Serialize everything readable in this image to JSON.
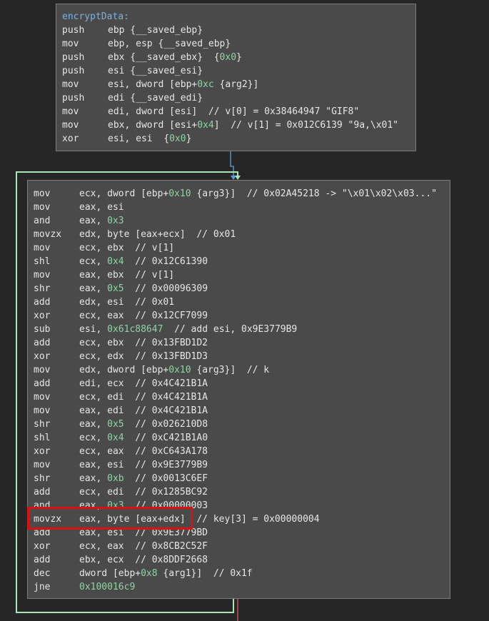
{
  "function_name": "encryptData:",
  "blocks": [
    {
      "lines": [
        {
          "m": "push",
          "o": [
            [
              "t",
              "ebp {__saved_ebp}"
            ]
          ]
        },
        {
          "m": "mov",
          "o": [
            [
              "t",
              "ebp, esp {__saved_ebp}"
            ]
          ]
        },
        {
          "m": "push",
          "o": [
            [
              "t",
              "ebx {__saved_ebx}  {"
            ],
            [
              "n",
              "0x0"
            ],
            [
              "t",
              "}"
            ]
          ]
        },
        {
          "m": "push",
          "o": [
            [
              "t",
              "esi {__saved_esi}"
            ]
          ]
        },
        {
          "m": "mov",
          "o": [
            [
              "t",
              "esi, dword [ebp+"
            ],
            [
              "n",
              "0xc"
            ],
            [
              "t",
              " {arg2}]"
            ]
          ]
        },
        {
          "m": "push",
          "o": [
            [
              "t",
              "edi {__saved_edi}"
            ]
          ]
        },
        {
          "m": "mov",
          "o": [
            [
              "t",
              "edi, dword [esi]  // v[0] = 0x38464947 \"GIF8\""
            ]
          ]
        },
        {
          "m": "mov",
          "o": [
            [
              "t",
              "ebx, dword [esi+"
            ],
            [
              "n",
              "0x4"
            ],
            [
              "t",
              "]  // v[1] = 0x012C6139 \"9a,\\x01\""
            ]
          ]
        },
        {
          "m": "xor",
          "o": [
            [
              "t",
              "esi, esi  {"
            ],
            [
              "n",
              "0x0"
            ],
            [
              "t",
              "}"
            ]
          ]
        }
      ]
    },
    {
      "lines": [
        {
          "m": "mov",
          "o": [
            [
              "t",
              "ecx, dword [ebp+"
            ],
            [
              "n",
              "0x10"
            ],
            [
              "t",
              " {arg3}]  // 0x02A45218 -> \"\\x01\\x02\\x03...\""
            ]
          ]
        },
        {
          "m": "mov",
          "o": [
            [
              "t",
              "eax, esi"
            ]
          ]
        },
        {
          "m": "and",
          "o": [
            [
              "t",
              "eax, "
            ],
            [
              "n",
              "0x3"
            ]
          ]
        },
        {
          "m": "movzx",
          "o": [
            [
              "t",
              "edx, byte [eax+ecx]  // 0x01"
            ]
          ]
        },
        {
          "m": "mov",
          "o": [
            [
              "t",
              "ecx, ebx  // v[1]"
            ]
          ]
        },
        {
          "m": "shl",
          "o": [
            [
              "t",
              "ecx, "
            ],
            [
              "n",
              "0x4"
            ],
            [
              "t",
              "  // 0x12C61390"
            ]
          ]
        },
        {
          "m": "mov",
          "o": [
            [
              "t",
              "eax, ebx  // v[1]"
            ]
          ]
        },
        {
          "m": "shr",
          "o": [
            [
              "t",
              "eax, "
            ],
            [
              "n",
              "0x5"
            ],
            [
              "t",
              "  // 0x00096309"
            ]
          ]
        },
        {
          "m": "add",
          "o": [
            [
              "t",
              "edx, esi  // 0x01"
            ]
          ]
        },
        {
          "m": "xor",
          "o": [
            [
              "t",
              "ecx, eax  // 0x12CF7099"
            ]
          ]
        },
        {
          "m": "sub",
          "o": [
            [
              "t",
              "esi, "
            ],
            [
              "n",
              "0x61c88647"
            ],
            [
              "t",
              "  // add esi, 0x9E3779B9"
            ]
          ]
        },
        {
          "m": "add",
          "o": [
            [
              "t",
              "ecx, ebx  // 0x13FBD1D2"
            ]
          ]
        },
        {
          "m": "xor",
          "o": [
            [
              "t",
              "ecx, edx  // 0x13FBD1D3"
            ]
          ]
        },
        {
          "m": "mov",
          "o": [
            [
              "t",
              "edx, dword [ebp+"
            ],
            [
              "n",
              "0x10"
            ],
            [
              "t",
              " {arg3}]  // k"
            ]
          ]
        },
        {
          "m": "add",
          "o": [
            [
              "t",
              "edi, ecx  // 0x4C421B1A"
            ]
          ]
        },
        {
          "m": "mov",
          "o": [
            [
              "t",
              "ecx, edi  // 0x4C421B1A"
            ]
          ]
        },
        {
          "m": "mov",
          "o": [
            [
              "t",
              "eax, edi  // 0x4C421B1A"
            ]
          ]
        },
        {
          "m": "shr",
          "o": [
            [
              "t",
              "eax, "
            ],
            [
              "n",
              "0x5"
            ],
            [
              "t",
              "  // 0x026210D8"
            ]
          ]
        },
        {
          "m": "shl",
          "o": [
            [
              "t",
              "ecx, "
            ],
            [
              "n",
              "0x4"
            ],
            [
              "t",
              "  // 0xC421B1A0"
            ]
          ]
        },
        {
          "m": "xor",
          "o": [
            [
              "t",
              "ecx, eax  // 0xC643A178"
            ]
          ]
        },
        {
          "m": "mov",
          "o": [
            [
              "t",
              "eax, esi  // 0x9E3779B9"
            ]
          ]
        },
        {
          "m": "shr",
          "o": [
            [
              "t",
              "eax, "
            ],
            [
              "n",
              "0xb"
            ],
            [
              "t",
              "  // 0x0013C6EF"
            ]
          ]
        },
        {
          "m": "add",
          "o": [
            [
              "t",
              "ecx, edi  // 0x1285BC92"
            ]
          ]
        },
        {
          "m": "and",
          "o": [
            [
              "t",
              "eax, "
            ],
            [
              "n",
              "0x3"
            ],
            [
              "t",
              "  // 0x00000003"
            ]
          ]
        },
        {
          "m": "movzx",
          "o": [
            [
              "t",
              "eax, byte [eax+edx]  // key[3] = 0x00000004"
            ]
          ]
        },
        {
          "m": "add",
          "o": [
            [
              "t",
              "eax, esi  // 0x9E3779BD"
            ]
          ]
        },
        {
          "m": "xor",
          "o": [
            [
              "t",
              "ecx, eax  // 0x8CB2C52F"
            ]
          ]
        },
        {
          "m": "add",
          "o": [
            [
              "t",
              "ebx, ecx  // 0x8DDF2668"
            ]
          ]
        },
        {
          "m": "dec",
          "o": [
            [
              "t",
              "dword [ebp+"
            ],
            [
              "n",
              "0x8"
            ],
            [
              "t",
              " {arg1}]  // 0x1f"
            ]
          ]
        },
        {
          "m": "jne",
          "o": [
            [
              "n",
              "0x100016c9"
            ]
          ]
        }
      ]
    }
  ],
  "colors": {
    "background": "#262626",
    "block": "#4a4a4a",
    "label": "#76b4e2",
    "number": "#8fd3a6",
    "edge_fallthrough": "#5aa0d8",
    "edge_loop": "#a8e6b8",
    "edge_exit": "#e06060",
    "highlight": "#e01010"
  }
}
